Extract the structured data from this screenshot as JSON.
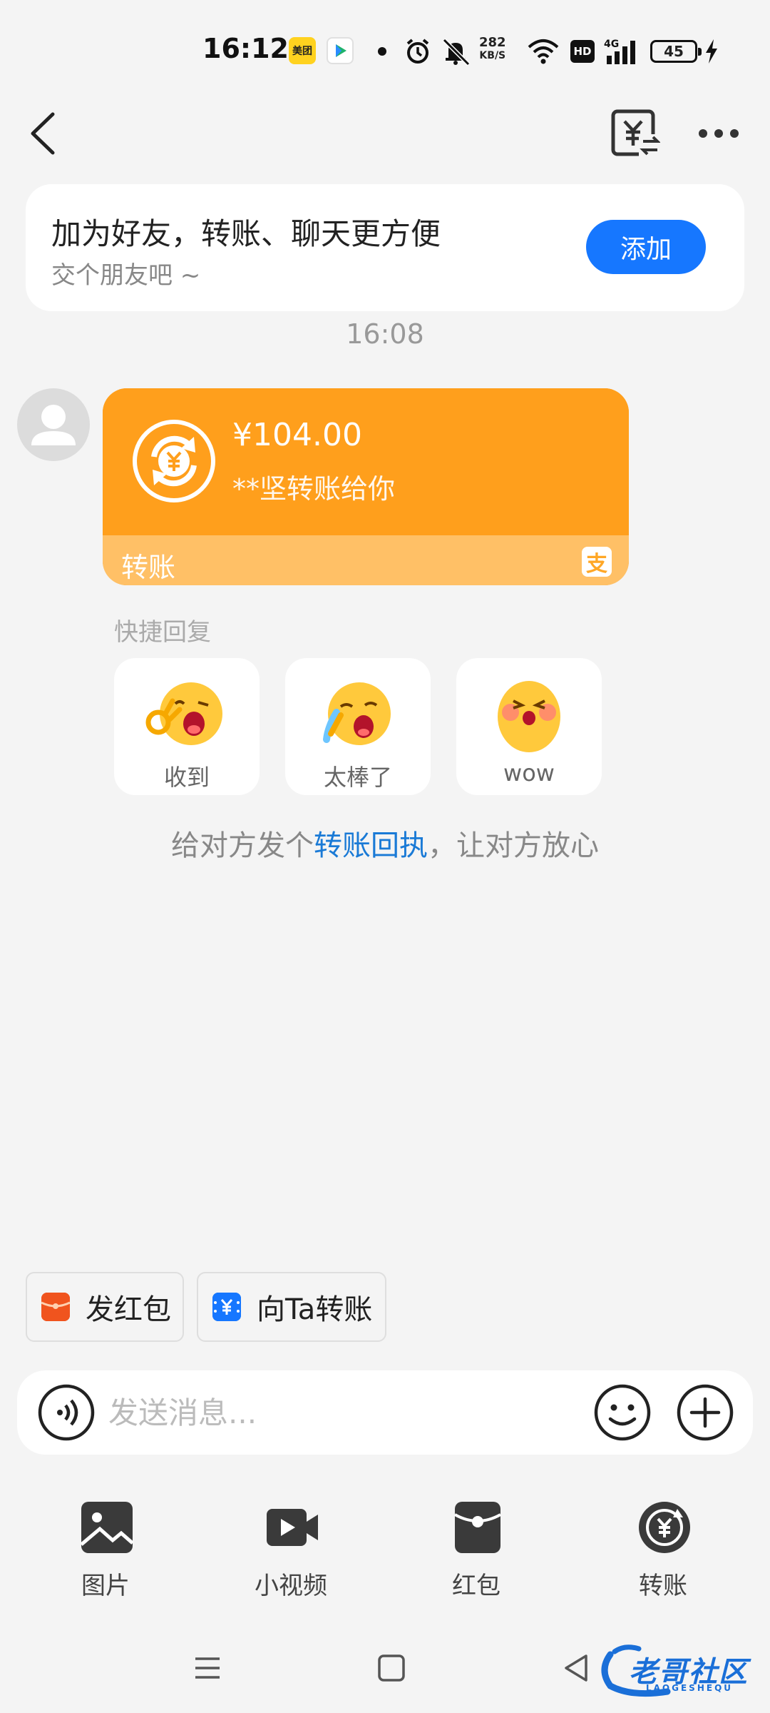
{
  "status_bar": {
    "time": "16:12",
    "app_icon_1": "美团",
    "net_speed_value": "282",
    "net_speed_unit": "KB/S",
    "hd": "HD",
    "network": "4G",
    "battery": "45"
  },
  "nav": {
    "back_icon": "chevron-left-icon",
    "transfer_icon": "yuan-exchange-icon",
    "more_icon": "more-dots-icon"
  },
  "friend_card": {
    "title": "加为好友，转账、聊天更方便",
    "subtitle": "交个朋友吧 ~",
    "add_label": "添加"
  },
  "message_time": "16:08",
  "transfer_message": {
    "amount": "¥104.00",
    "note": "**坚转账给你",
    "label": "转账",
    "accent": "#ff9f1c"
  },
  "quick_reply": {
    "label": "快捷回复",
    "items": [
      {
        "text": "收到",
        "icon": "ok-emoji-icon"
      },
      {
        "text": "太棒了",
        "icon": "tears-of-joy-emoji-icon"
      },
      {
        "text": "wow",
        "icon": "wow-emoji-icon"
      }
    ]
  },
  "receipt_hint": {
    "prefix": "给对方发个",
    "link": "转账回执",
    "suffix": "，让对方放心"
  },
  "quick_buttons": {
    "red_packet": "发红包",
    "transfer_to": "向Ta转账"
  },
  "input": {
    "placeholder": "发送消息..."
  },
  "toolbar": {
    "items": [
      {
        "label": "图片"
      },
      {
        "label": "小视频"
      },
      {
        "label": "红包"
      },
      {
        "label": "转账"
      }
    ]
  },
  "watermark": {
    "title": "老哥社区",
    "subtitle": "LAOGESHEQU"
  }
}
